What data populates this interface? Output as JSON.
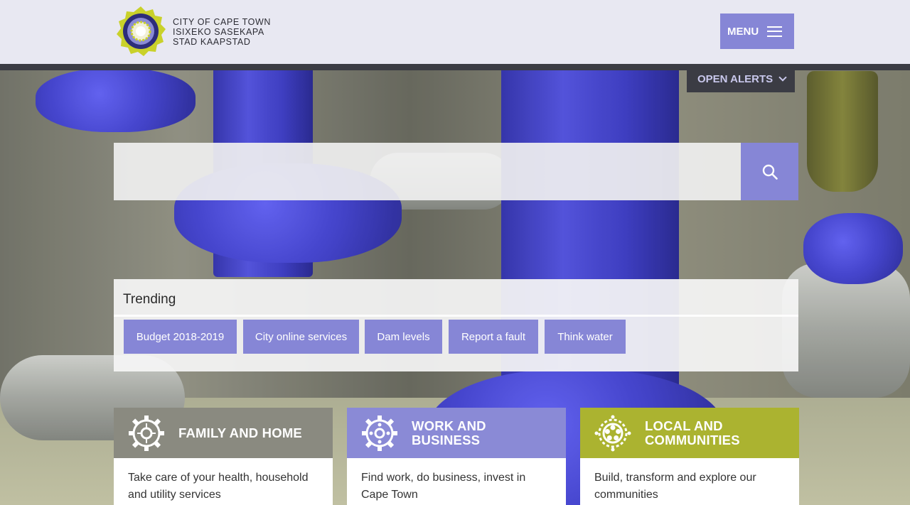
{
  "header": {
    "logo_lines": [
      "CITY OF CAPE TOWN",
      "ISIXEKO SASEKAPA",
      "STAD KAAPSTAD"
    ],
    "menu_label": "MENU"
  },
  "alerts": {
    "label": "OPEN ALERTS"
  },
  "search": {
    "placeholder": "",
    "icon": "search-icon"
  },
  "trending": {
    "title": "Trending",
    "items": [
      "Budget 2018-2019",
      "City online services",
      "Dam levels",
      "Report a fault",
      "Think water"
    ]
  },
  "cards": [
    {
      "title_line1": "FAMILY AND HOME",
      "title_line2": "",
      "description": "Take care of your health, household and utility services",
      "color": "#8a8a80"
    },
    {
      "title_line1": "WORK AND",
      "title_line2": "BUSINESS",
      "description": "Find work, do business, invest in Cape Town",
      "color": "#8a8ad6"
    },
    {
      "title_line1": "LOCAL AND",
      "title_line2": "COMMUNITIES",
      "description": "Build, transform and explore our communities",
      "color": "#abb330"
    }
  ],
  "colors": {
    "accent": "#8686d6",
    "dark_bar": "#3b3c44",
    "header_bg": "#ececf8"
  }
}
